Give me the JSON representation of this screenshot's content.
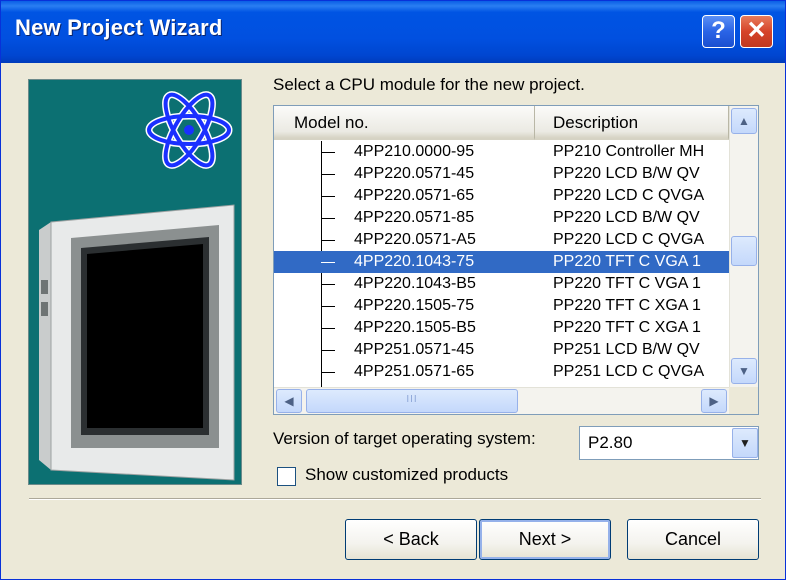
{
  "window": {
    "title": "New Project Wizard"
  },
  "titlebar": {
    "help_label": "?",
    "close_label": "✕"
  },
  "prompt": "Select a CPU module for the new project.",
  "table": {
    "columns": [
      "Model no.",
      "Description"
    ],
    "selected_index": 5,
    "rows": [
      {
        "model": "4PP210.0000-95",
        "desc": "PP210 Controller MH"
      },
      {
        "model": "4PP220.0571-45",
        "desc": "PP220 LCD B/W QV"
      },
      {
        "model": "4PP220.0571-65",
        "desc": "PP220 LCD C QVGA"
      },
      {
        "model": "4PP220.0571-85",
        "desc": "PP220 LCD B/W QV"
      },
      {
        "model": "4PP220.0571-A5",
        "desc": "PP220 LCD C QVGA"
      },
      {
        "model": "4PP220.1043-75",
        "desc": "PP220 TFT C VGA 1"
      },
      {
        "model": "4PP220.1043-B5",
        "desc": "PP220 TFT C VGA 1"
      },
      {
        "model": "4PP220.1505-75",
        "desc": "PP220 TFT C XGA 1"
      },
      {
        "model": "4PP220.1505-B5",
        "desc": "PP220 TFT C XGA 1"
      },
      {
        "model": "4PP251.0571-45",
        "desc": "PP251 LCD B/W QV"
      },
      {
        "model": "4PP251.0571-65",
        "desc": "PP251 LCD C QVGA"
      }
    ]
  },
  "scrollbar": {
    "up": "▲",
    "down": "▼",
    "left": "◀",
    "right": "▶",
    "grip": "III"
  },
  "os_version": {
    "label": "Version of target operating system:",
    "value": "P2.80",
    "dropdown_glyph": "▼"
  },
  "show_customized": {
    "label": "Show customized products",
    "checked": false
  },
  "buttons": {
    "back": "< Back",
    "next": "Next >",
    "cancel": "Cancel"
  },
  "colors": {
    "titlebar": "#0054e3",
    "selection": "#316ac5",
    "panel": "#0c7072",
    "dialog_bg": "#ece9d8"
  },
  "icons": [
    "atom-icon",
    "panel-pc-image",
    "help-icon",
    "close-icon"
  ]
}
